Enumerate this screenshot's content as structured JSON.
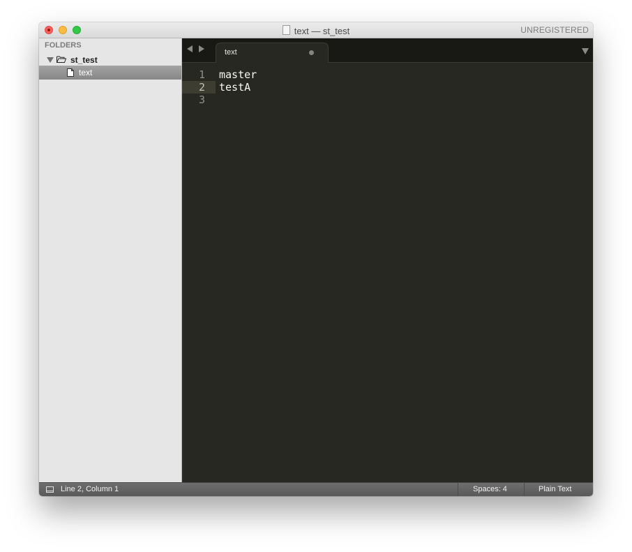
{
  "window": {
    "title": "text — st_test",
    "unregistered_label": "UNREGISTERED"
  },
  "sidebar": {
    "header": "FOLDERS",
    "folder": {
      "name": "st_test",
      "icon": "folder-open-icon"
    },
    "files": [
      {
        "name": "text",
        "icon": "file-icon",
        "selected": true
      }
    ]
  },
  "tabs": [
    {
      "label": "text",
      "dirty": true,
      "active": true
    }
  ],
  "editor": {
    "line_numbers": [
      "1",
      "2",
      "3"
    ],
    "lines": [
      "master",
      "testA",
      ""
    ],
    "current_line": 2
  },
  "statusbar": {
    "position": "Line 2, Column 1",
    "indentation": "Spaces: 4",
    "syntax": "Plain Text"
  },
  "colors": {
    "editor_bg": "#272822",
    "tabbar_bg": "#181815",
    "sidebar_bg": "#e6e6e6",
    "selected_row": "#939393"
  }
}
